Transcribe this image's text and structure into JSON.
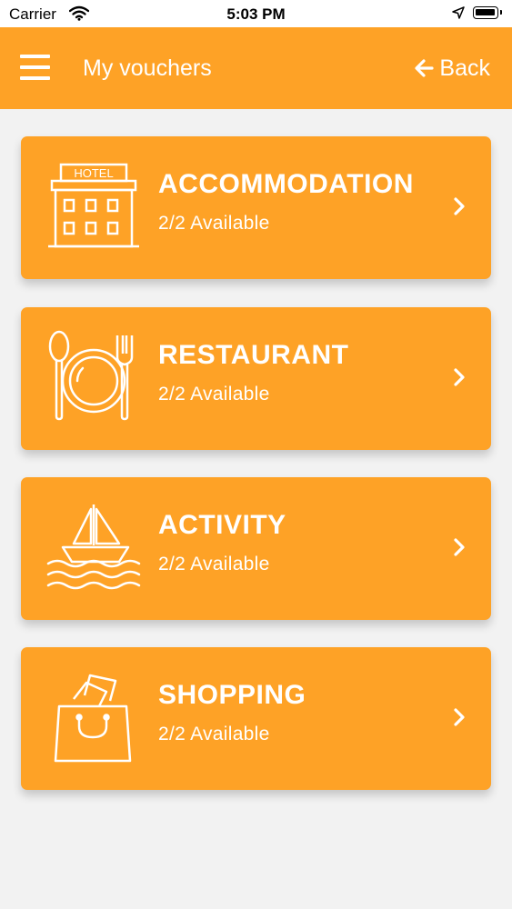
{
  "status_bar": {
    "carrier": "Carrier",
    "time": "5:03 PM",
    "icons": [
      "wifi-icon",
      "location-arrow-icon",
      "battery-icon"
    ]
  },
  "header": {
    "title": "My vouchers",
    "back_label": "Back",
    "icons": [
      "hamburger-menu-icon",
      "arrow-left-icon"
    ]
  },
  "vouchers": [
    {
      "title": "ACCOMMODATION",
      "availability": "2/2 Available",
      "icon": "hotel-icon",
      "icon_text": "HOTEL"
    },
    {
      "title": "RESTAURANT",
      "availability": "2/2 Available",
      "icon": "plate-cutlery-icon"
    },
    {
      "title": "ACTIVITY",
      "availability": "2/2 Available",
      "icon": "sailboat-icon"
    },
    {
      "title": "SHOPPING",
      "availability": "2/2 Available",
      "icon": "shopping-bag-icon"
    }
  ],
  "colors": {
    "accent": "#fea226",
    "background": "#f2f2f2",
    "text_on_accent": "#ffffff"
  }
}
